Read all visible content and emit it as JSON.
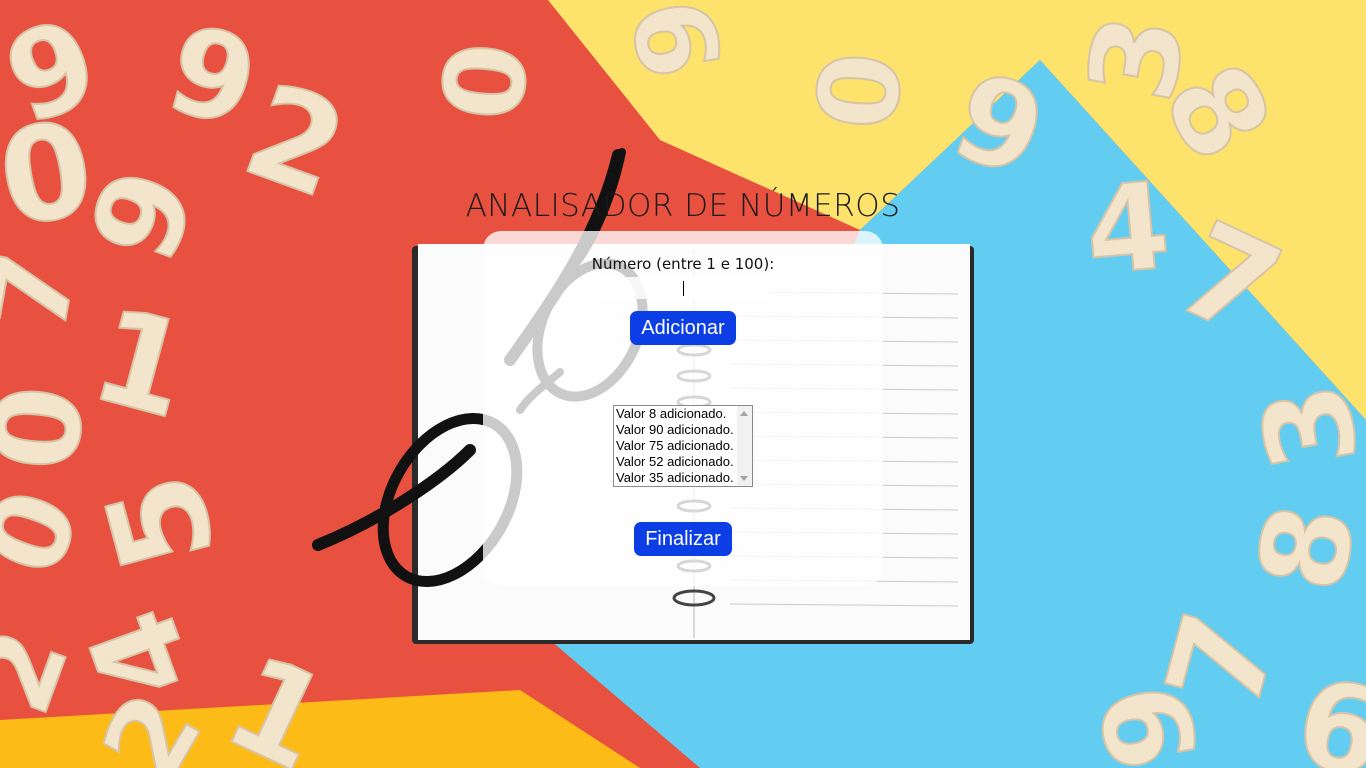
{
  "page": {
    "title": "ANALISADOR DE NÚMEROS",
    "background_colors": {
      "red": "#e8503f",
      "yellow": "#fde36c",
      "blue": "#62cdf0",
      "orange": "#fdbb18",
      "numeral": "#f3e4cc"
    }
  },
  "form": {
    "number_label": "Número (entre 1 e 100):",
    "number_value": "",
    "add_button": "Adicionar",
    "finish_button": "Finalizar",
    "accent_color": "#0c3ee6"
  },
  "values_list": {
    "items": [
      "Valor 8 adicionado.",
      "Valor 90 adicionado.",
      "Valor 75 adicionado.",
      "Valor 52 adicionado.",
      "Valor 35 adicionado."
    ]
  }
}
